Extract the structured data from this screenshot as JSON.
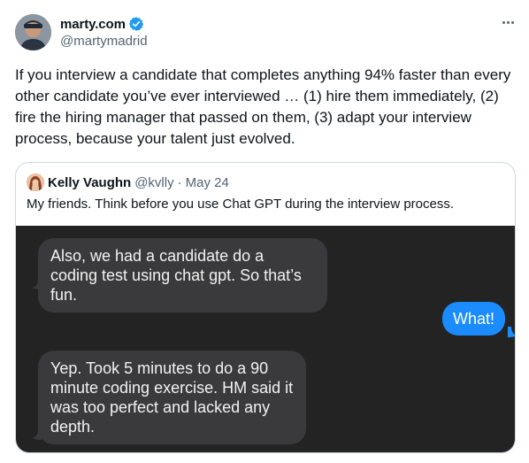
{
  "tweet": {
    "author_name": "marty.com",
    "author_handle": "@martymadrid",
    "text": "If you interview a candidate that completes anything 94% faster than every other candidate you’ve ever interviewed … (1) hire them immediately, (2) fire the hiring manager that passed on them, (3) adapt your interview process, because your talent just evolved."
  },
  "quote": {
    "author_name": "Kelly Vaughn",
    "author_handle": "@kvlly",
    "separator": "·",
    "date": "May 24",
    "text": "My friends. Think before you use Chat GPT during the interview process."
  },
  "chat": {
    "messages": [
      {
        "side": "left",
        "text": "Also, we had a candidate do a coding test using chat gpt. So that’s fun."
      },
      {
        "side": "right",
        "text": "What!"
      },
      {
        "side": "left",
        "text": "Yep. Took 5 minutes to do a 90 minute coding exercise. HM said it was too perfect and lacked any depth."
      }
    ]
  },
  "colors": {
    "verified_blue": "#1d9bf0",
    "chat_background": "#232323",
    "incoming_bubble": "#3a3a3c",
    "outgoing_bubble": "#1a8cff"
  },
  "icons": {
    "verified": "verified-badge-icon",
    "more": "more-options-icon"
  }
}
